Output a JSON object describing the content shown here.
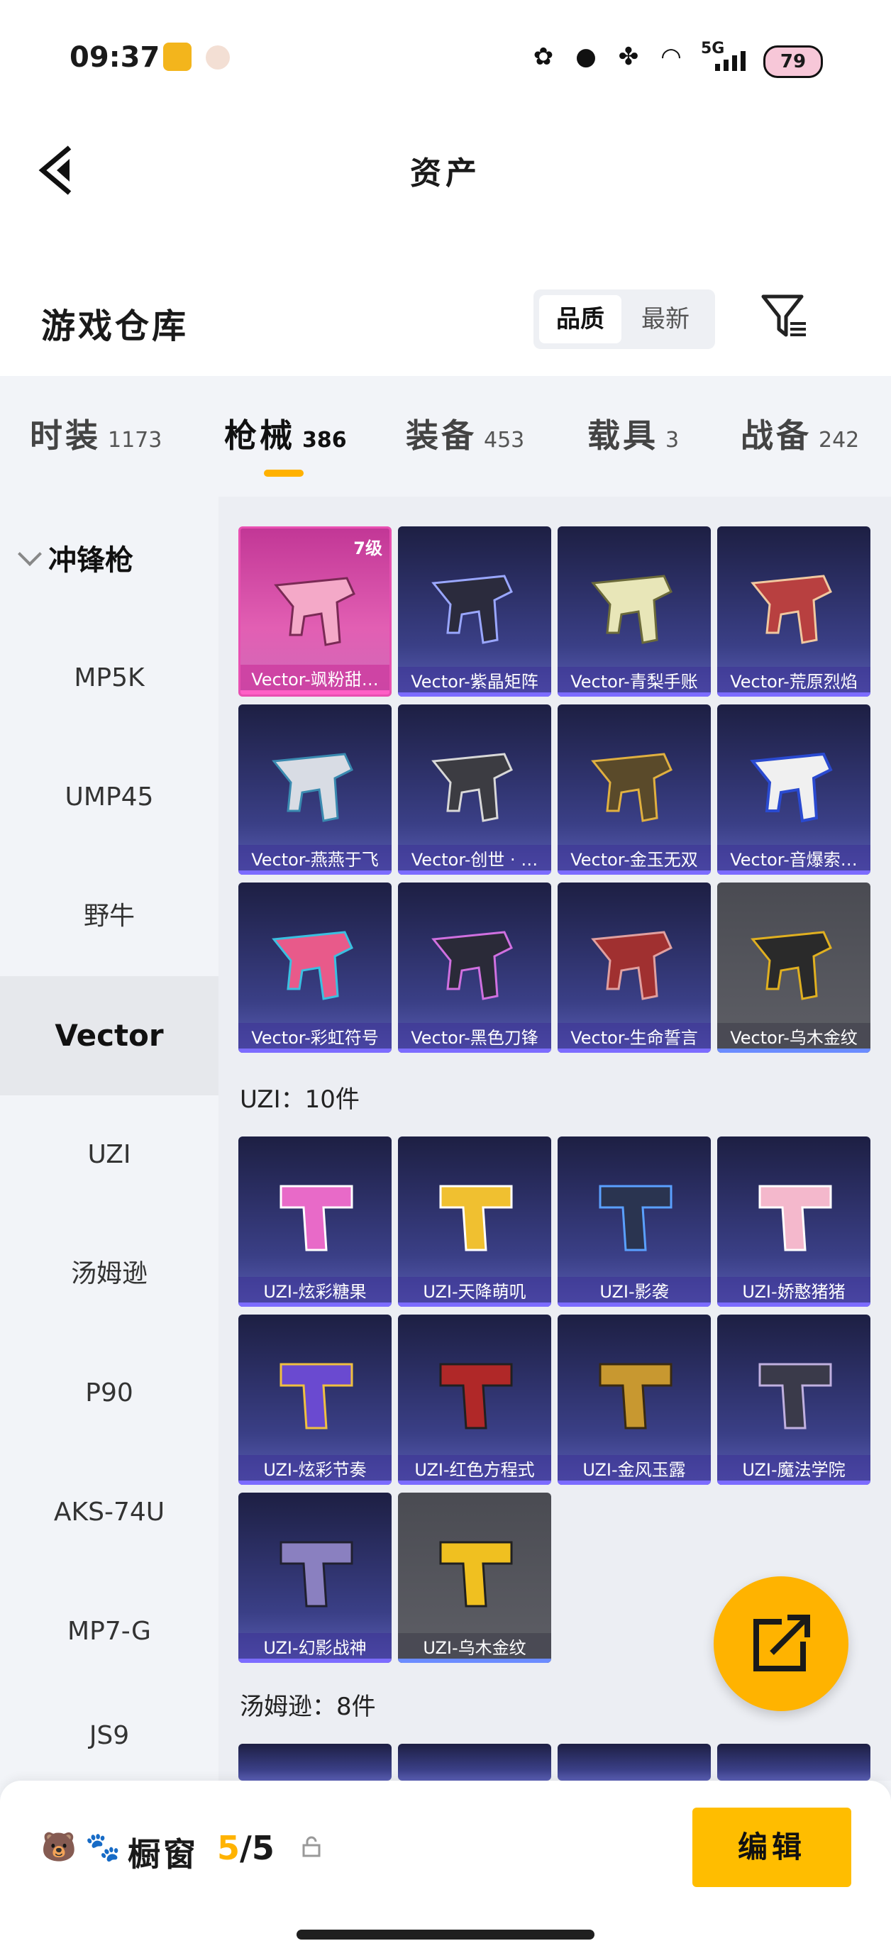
{
  "status": {
    "time": "09:37",
    "network": "5G",
    "battery": "79"
  },
  "header": {
    "title": "资产"
  },
  "warehouse": {
    "title": "游戏仓库",
    "sort_quality": "品质",
    "sort_newest": "最新"
  },
  "tabs": [
    {
      "label": "时装",
      "count": "1173"
    },
    {
      "label": "枪械",
      "count": "386"
    },
    {
      "label": "装备",
      "count": "453"
    },
    {
      "label": "载具",
      "count": "3"
    },
    {
      "label": "战备",
      "count": "242"
    }
  ],
  "sidebar": {
    "group": "冲锋枪",
    "items": [
      "MP5K",
      "UMP45",
      "野牛",
      "Vector",
      "UZI",
      "汤姆逊",
      "P90",
      "AKS-74U",
      "MP7-G",
      "JS9"
    ]
  },
  "vector": {
    "level_badge": "7级",
    "items": [
      "Vector-飒粉甜…",
      "Vector-紫晶矩阵",
      "Vector-青梨手账",
      "Vector-荒原烈焰",
      "Vector-燕燕于飞",
      "Vector-创世 · …",
      "Vector-金玉无双",
      "Vector-音爆索…",
      "Vector-彩虹符号",
      "Vector-黑色刀锋",
      "Vector-生命誓言",
      "Vector-乌木金纹"
    ]
  },
  "uzi": {
    "section": "UZI：10件",
    "items": [
      "UZI-炫彩糖果",
      "UZI-天降萌叽",
      "UZI-影袭",
      "UZI-娇憨猪猪",
      "UZI-炫彩节奏",
      "UZI-红色方程式",
      "UZI-金风玉露",
      "UZI-魔法学院",
      "UZI-幻影战神",
      "UZI-乌木金纹"
    ]
  },
  "thompson": {
    "section": "汤姆逊：8件"
  },
  "showcase": {
    "title": "橱窗",
    "current": "5",
    "separator": "/",
    "total": "5",
    "edit": "编辑"
  },
  "colors": {
    "accent": "#ffb300",
    "card_purple": "#3a3f86",
    "card_pink": "#e25fb3",
    "card_grey": "#5e5f66"
  },
  "icons": [
    "back-arrow-icon",
    "filter-icon",
    "share-icon",
    "lock-icon",
    "chevron-down-icon"
  ]
}
